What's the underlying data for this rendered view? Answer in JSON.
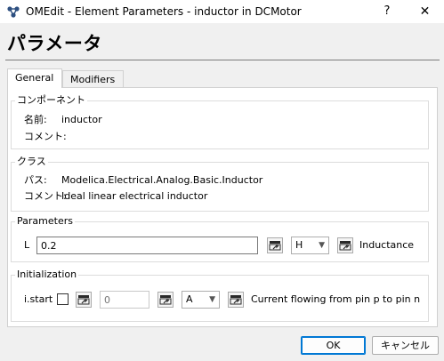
{
  "window": {
    "title": "OMEdit - Element Parameters - inductor in DCMotor",
    "help_label": "?",
    "close_label": "✕"
  },
  "heading": "パラメータ",
  "tabs": [
    {
      "label": "General",
      "active": true
    },
    {
      "label": "Modifiers",
      "active": false
    }
  ],
  "component": {
    "title": "コンポーネント",
    "name_label": "名前:",
    "name_value": "inductor",
    "comment_label": "コメント:"
  },
  "class": {
    "title": "クラス",
    "path_label": "パス:",
    "path_value": "Modelica.Electrical.Analog.Basic.Inductor",
    "comment_label": "コメント:",
    "comment_value": "Ideal linear electrical inductor"
  },
  "parameters": {
    "title": "Parameters",
    "L": {
      "label": "L",
      "value": "0.2",
      "unit": "H",
      "description": "Inductance"
    }
  },
  "initialization": {
    "title": "Initialization",
    "istart": {
      "label": "i.start",
      "checked": false,
      "placeholder": "0",
      "unit": "A",
      "description": "Current flowing from pin p to pin n"
    }
  },
  "buttons": {
    "ok": "OK",
    "cancel": "キャンセル"
  },
  "colors": {
    "accent": "#0078d4",
    "background": "#f0f0f0",
    "panel": "#ffffff"
  }
}
